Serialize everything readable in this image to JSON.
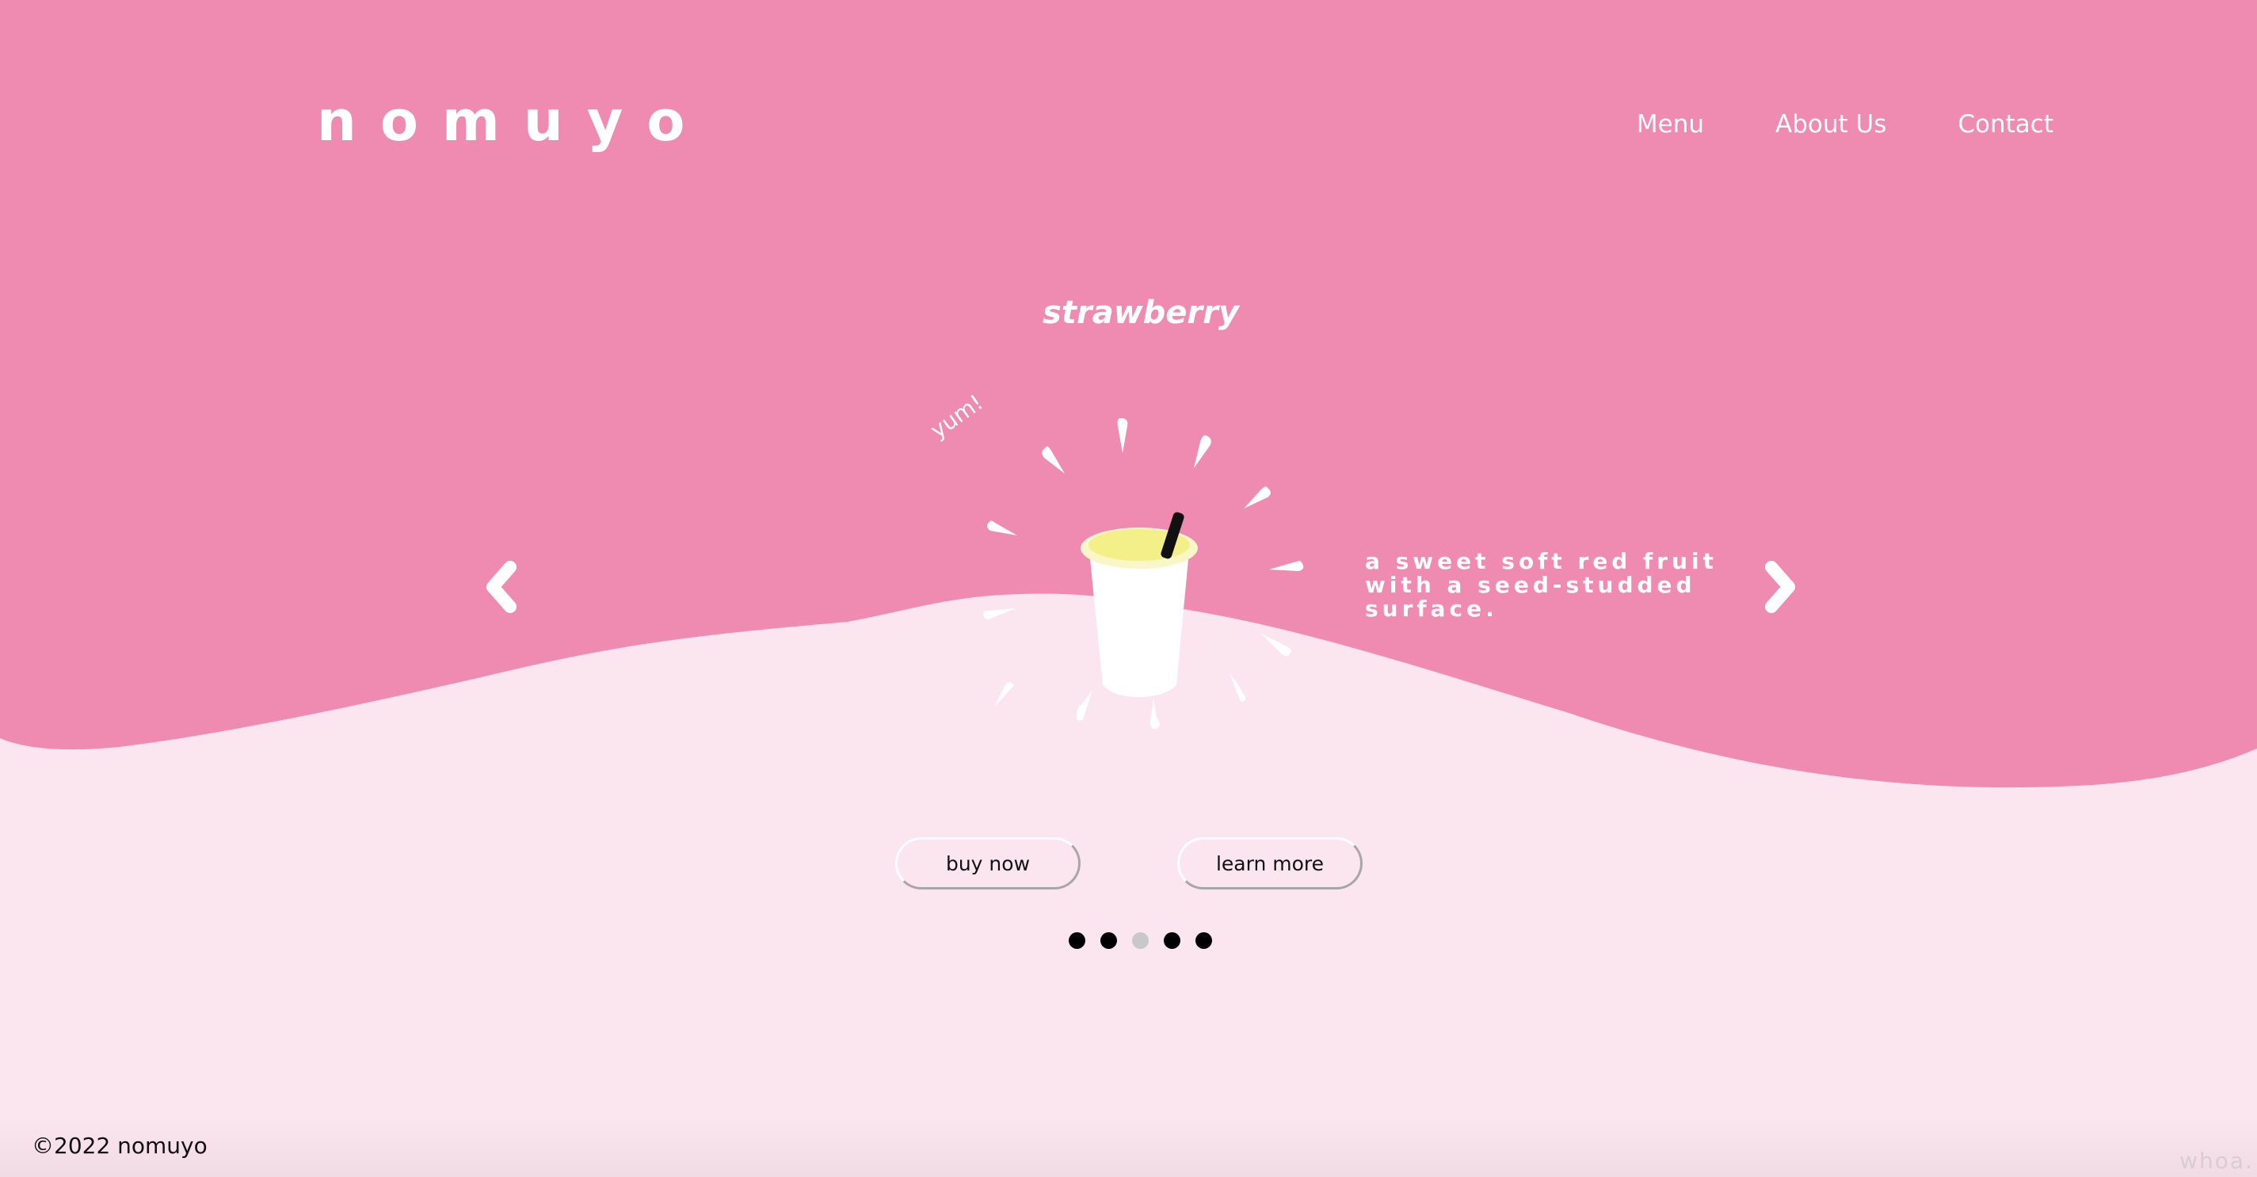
{
  "brand": {
    "logo": "nomuyo"
  },
  "nav": {
    "items": [
      {
        "label": "Menu"
      },
      {
        "label": "About Us"
      },
      {
        "label": "Contact"
      }
    ]
  },
  "hero": {
    "flavor_title": "strawberry",
    "exclaim": "yum!",
    "description": "a sweet soft red fruit with a seed-studded surface.",
    "prev_icon": "chevron-left-icon",
    "next_icon": "chevron-right-icon"
  },
  "actions": {
    "buy_label": "buy now",
    "learn_label": "learn more"
  },
  "carousel": {
    "total": 5,
    "active_index": 2
  },
  "footer": {
    "copyright": "©2022 nomuyo",
    "watermark": "whoa."
  },
  "colors": {
    "top_pink": "#ef8bb0",
    "bottom_pink": "#fbe5ee",
    "cup_lid": "#f7f3a6",
    "text_white": "#ffffff"
  }
}
